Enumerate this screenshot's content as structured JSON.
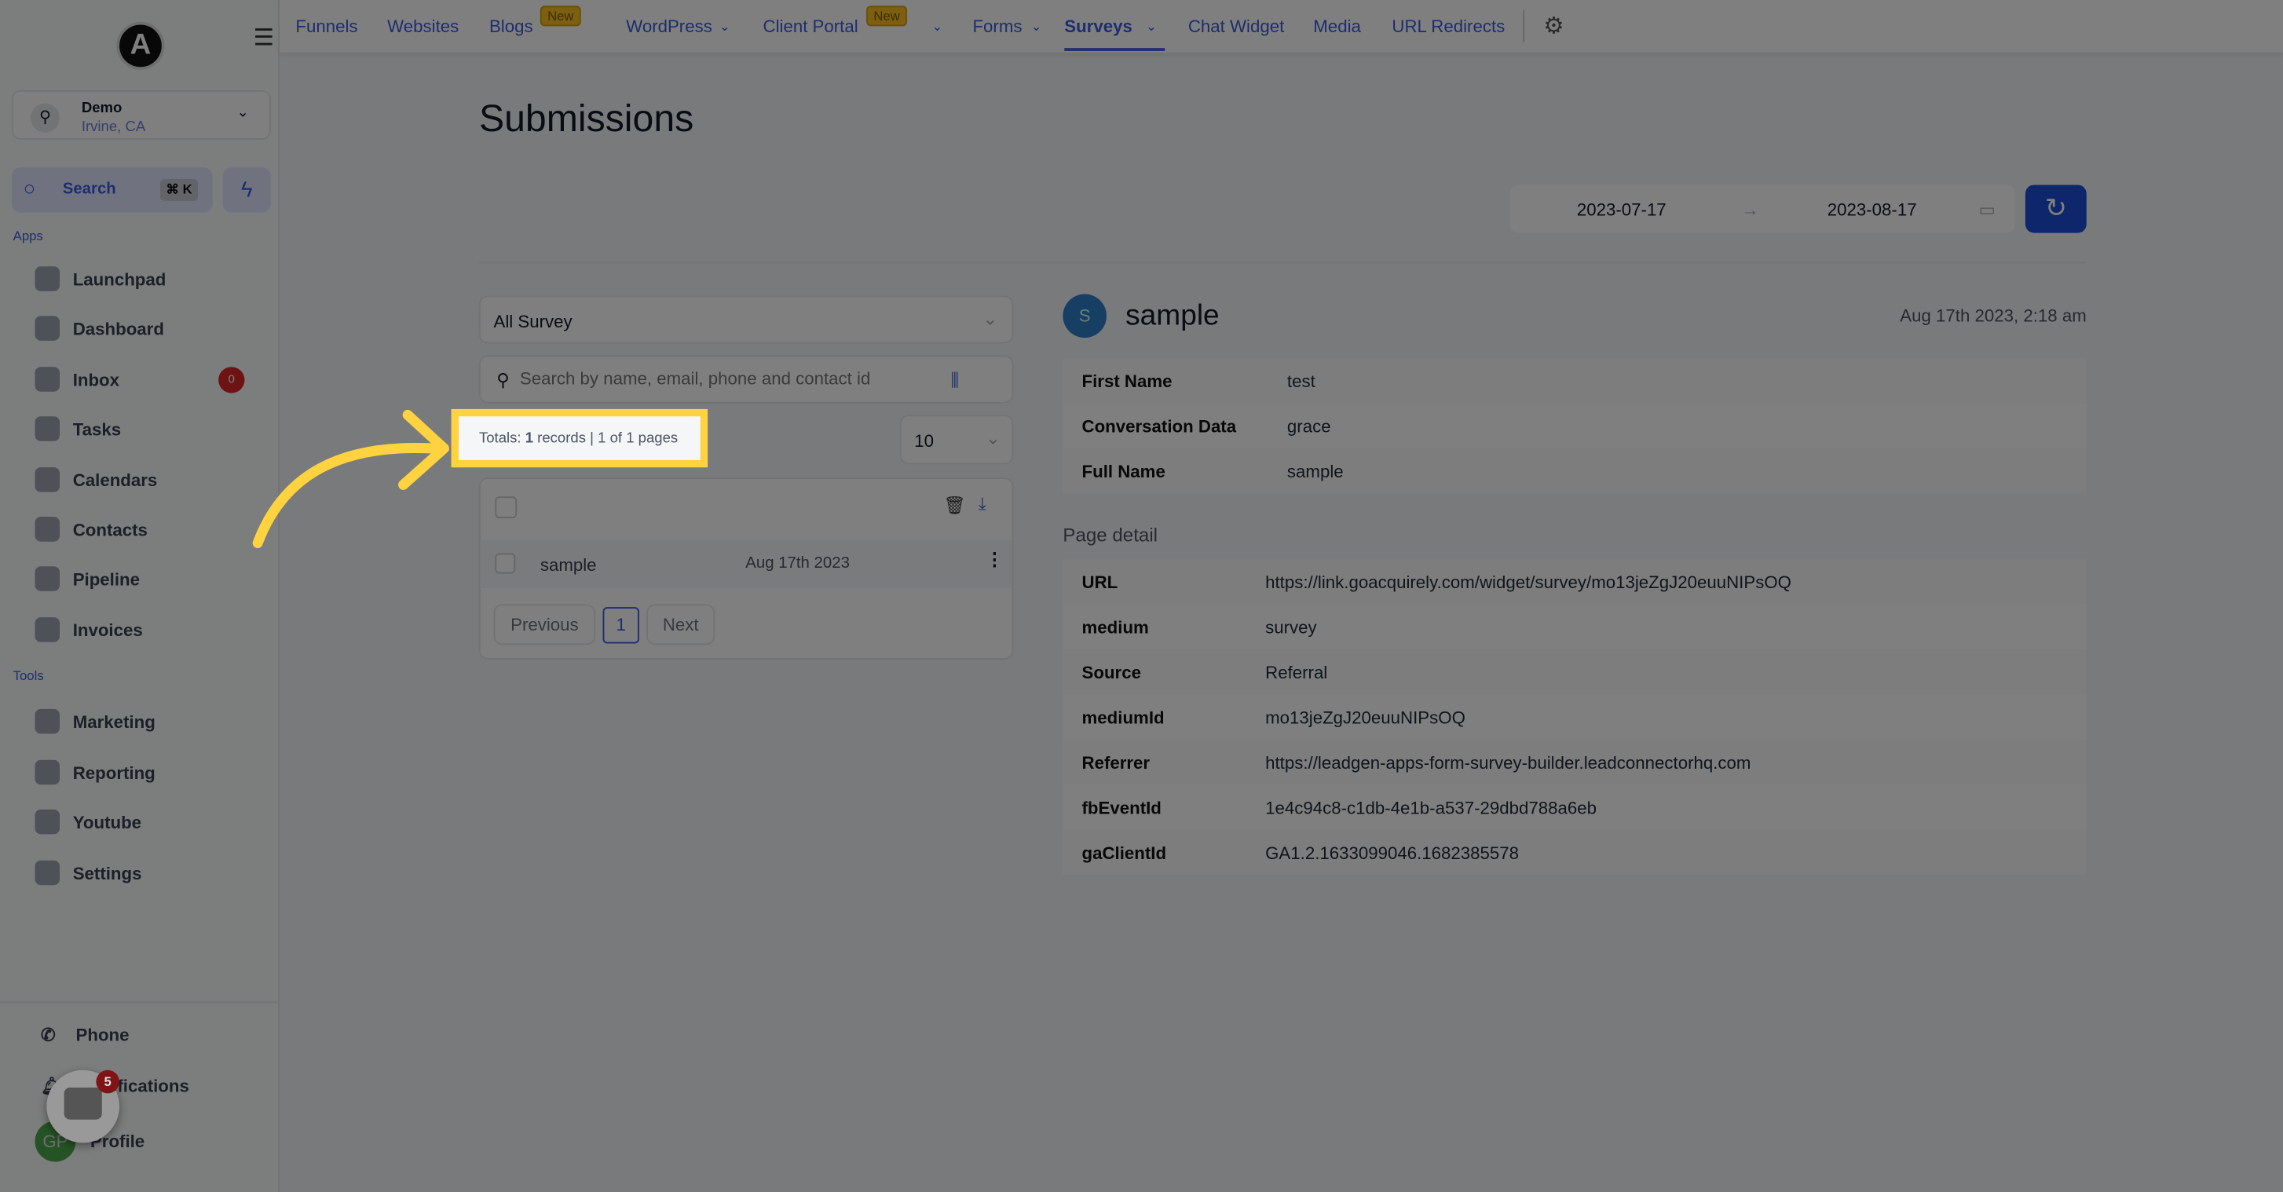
{
  "sidebar": {
    "logo": "A",
    "location": {
      "name": "Demo",
      "city": "Irvine, CA"
    },
    "search_label": "Search",
    "search_shortcut": "⌘ K",
    "apps_label": "Apps",
    "apps": [
      {
        "label": "Launchpad"
      },
      {
        "label": "Dashboard"
      },
      {
        "label": "Inbox",
        "badge": "0"
      },
      {
        "label": "Tasks"
      },
      {
        "label": "Calendars"
      },
      {
        "label": "Contacts"
      },
      {
        "label": "Pipeline"
      },
      {
        "label": "Invoices"
      }
    ],
    "tools_label": "Tools",
    "tools": [
      {
        "label": "Marketing"
      },
      {
        "label": "Reporting"
      },
      {
        "label": "Youtube"
      },
      {
        "label": "Settings"
      }
    ],
    "bottom": [
      {
        "label": "Phone"
      },
      {
        "label": "Notifications"
      },
      {
        "label": "Profile"
      }
    ],
    "profile_initials": "GP",
    "chat_badge": "5"
  },
  "topnav": {
    "items": [
      "Funnels",
      "Websites",
      "Blogs",
      "WordPress",
      "Client Portal",
      "Forms",
      "Surveys",
      "Chat Widget",
      "Media",
      "URL Redirects"
    ],
    "new_badge": "New",
    "active": "Surveys"
  },
  "page": {
    "title": "Submissions",
    "date_start": "2023-07-17",
    "date_end": "2023-08-17"
  },
  "list": {
    "survey_select": "All Survey",
    "search_placeholder": "Search by name, email, phone and contact id",
    "totals_prefix": "Totals: ",
    "totals_count": "1",
    "totals_suffix": " records | 1 of 1 pages",
    "page_size": "10",
    "rows": [
      {
        "name": "sample",
        "date": "Aug 17th 2023"
      }
    ],
    "prev": "Previous",
    "page": "1",
    "next": "Next"
  },
  "detail": {
    "avatar": "S",
    "name": "sample",
    "timestamp": "Aug 17th 2023, 2:18 am",
    "fields": [
      {
        "label": "First Name",
        "value": "test"
      },
      {
        "label": "Conversation Data",
        "value": "grace"
      },
      {
        "label": "Full Name",
        "value": "sample"
      }
    ],
    "page_detail_title": "Page detail",
    "page_detail": [
      {
        "label": "URL",
        "value": "https://link.goacquirely.com/widget/survey/mo13jeZgJ20euuNIPsOQ"
      },
      {
        "label": "medium",
        "value": "survey"
      },
      {
        "label": "Source",
        "value": "Referral"
      },
      {
        "label": "mediumId",
        "value": "mo13jeZgJ20euuNIPsOQ"
      },
      {
        "label": "Referrer",
        "value": "https://leadgen-apps-form-survey-builder.leadconnectorhq.com"
      },
      {
        "label": "fbEventId",
        "value": "1e4c94c8-c1db-4e1b-a537-29dbd788a6eb"
      },
      {
        "label": "gaClientId",
        "value": "GA1.2.1633099046.1682385578"
      }
    ]
  },
  "colors": {
    "accent": "#3b5bdb",
    "highlight": "#ffd23f",
    "refresh": "#1d4ed8"
  }
}
